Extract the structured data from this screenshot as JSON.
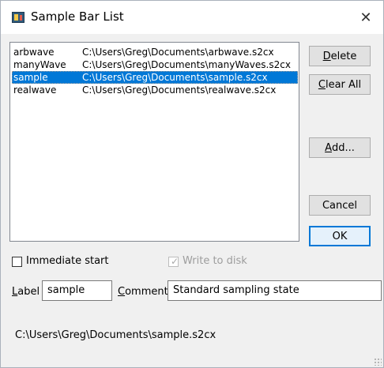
{
  "window": {
    "title": "Sample Bar List",
    "close_glyph": "✕"
  },
  "list": {
    "items": [
      {
        "name": "arbwave",
        "path": "C:\\Users\\Greg\\Documents\\arbwave.s2cx"
      },
      {
        "name": "manyWave",
        "path": "C:\\Users\\Greg\\Documents\\manyWaves.s2cx"
      },
      {
        "name": "sample",
        "path": "C:\\Users\\Greg\\Documents\\sample.s2cx"
      },
      {
        "name": "realwave",
        "path": "C:\\Users\\Greg\\Documents\\realwave.s2cx"
      }
    ],
    "selected_index": 2
  },
  "buttons": {
    "delete_pre": "",
    "delete_key": "D",
    "delete_post": "elete",
    "clear_pre": "",
    "clear_key": "C",
    "clear_post": "lear All",
    "add_pre": "",
    "add_key": "A",
    "add_post": "dd...",
    "cancel": "Cancel",
    "ok": "OK"
  },
  "options": {
    "immediate_start": "Immediate start",
    "immediate_start_checked": false,
    "write_to_disk": "Write to disk",
    "write_to_disk_checked": true,
    "write_to_disk_enabled": false,
    "check_glyph": "✓"
  },
  "fields": {
    "label_pre": "",
    "label_key": "L",
    "label_post": "abel",
    "label_value": "sample",
    "comment_pre": "",
    "comment_key": "C",
    "comment_post": "omment",
    "comment_value": "Standard sampling state"
  },
  "status": {
    "path": "C:\\Users\\Greg\\Documents\\sample.s2cx"
  },
  "colors": {
    "selection": "#0078d7",
    "default_button_border": "#0078d7"
  }
}
